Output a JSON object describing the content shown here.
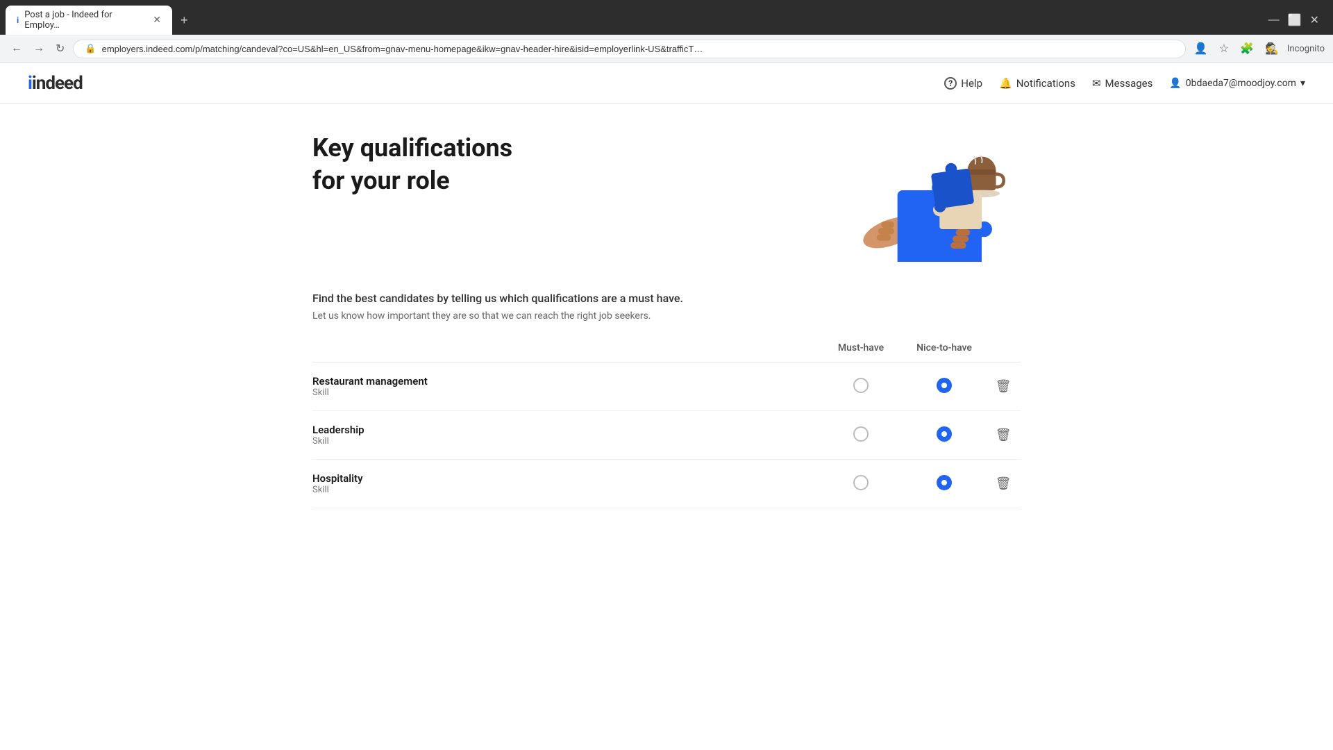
{
  "browser": {
    "tab_title": "Post a job - Indeed for Employ…",
    "url": "employers.indeed.com/p/matching/candeval?co=US&hl=en_US&from=gnav-menu-homepage&ikw=gnav-header-hire&isid=employerlink-US&trafficT…",
    "new_tab_label": "+",
    "controls": {
      "minimize": "—",
      "maximize": "⬜",
      "close": "✕"
    }
  },
  "header": {
    "logo_text": "indeed",
    "nav": {
      "help_label": "Help",
      "notifications_label": "Notifications",
      "messages_label": "Messages",
      "user_email": "0bdaeda7@moodjoy.com",
      "user_dropdown": "▾"
    }
  },
  "main": {
    "hero_title": "Key qualifications for your role",
    "intro_primary": "Find the best candidates by telling us which qualifications are a must have.",
    "intro_secondary": "Let us know how important they are so that we can reach the right job seekers.",
    "table_headers": {
      "must_have": "Must-have",
      "nice_to_have": "Nice-to-have"
    },
    "qualifications": [
      {
        "id": "restaurant-management",
        "title": "Restaurant management",
        "type": "Skill",
        "must_have": false,
        "nice_to_have": true
      },
      {
        "id": "leadership",
        "title": "Leadership",
        "type": "Skill",
        "must_have": false,
        "nice_to_have": true
      },
      {
        "id": "hospitality",
        "title": "Hospitality",
        "type": "Skill",
        "must_have": false,
        "nice_to_have": true
      }
    ]
  },
  "icons": {
    "help": "?",
    "bell": "🔔",
    "mail": "✉",
    "user": "👤",
    "trash": "🗑",
    "back": "←",
    "forward": "→",
    "reload": "↻",
    "lock": "🔒",
    "star": "☆",
    "incognito": "🕵",
    "extensions": "🧩"
  }
}
